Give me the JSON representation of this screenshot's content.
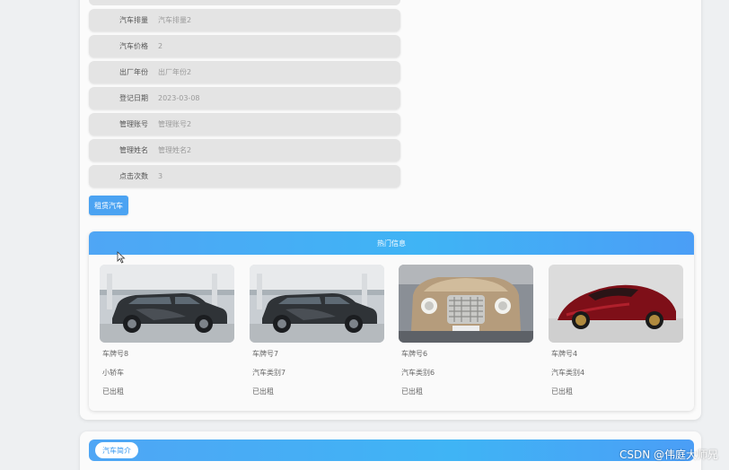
{
  "details": [
    {
      "label": "汽车排量",
      "value": "汽车排量2"
    },
    {
      "label": "汽车价格",
      "value": "2"
    },
    {
      "label": "出厂年份",
      "value": "出厂年份2"
    },
    {
      "label": "登记日期",
      "value": "2023-03-08"
    },
    {
      "label": "管理账号",
      "value": "管理账号2"
    },
    {
      "label": "管理姓名",
      "value": "管理姓名2"
    },
    {
      "label": "点击次数",
      "value": "3"
    }
  ],
  "rent_button": "租赁汽车",
  "hot": {
    "title": "热门信息",
    "cars": [
      {
        "plate": "车牌号8",
        "category": "小轿车",
        "status": "已出租",
        "icon": "suv-photo"
      },
      {
        "plate": "车牌号7",
        "category": "汽车类别7",
        "status": "已出租",
        "icon": "suv-photo"
      },
      {
        "plate": "车牌号6",
        "category": "汽车类别6",
        "status": "已出租",
        "icon": "bentley-photo"
      },
      {
        "plate": "车牌号4",
        "category": "汽车类别4",
        "status": "已出租",
        "icon": "mclaren-photo"
      }
    ]
  },
  "intro": {
    "tab": "汽车简介"
  },
  "watermark": "CSDN @伟庭大师兄",
  "colors": {
    "accent": "#4ba3f2",
    "header_gradient_start": "#4fa6f5",
    "header_gradient_end": "#4b9ef6"
  }
}
